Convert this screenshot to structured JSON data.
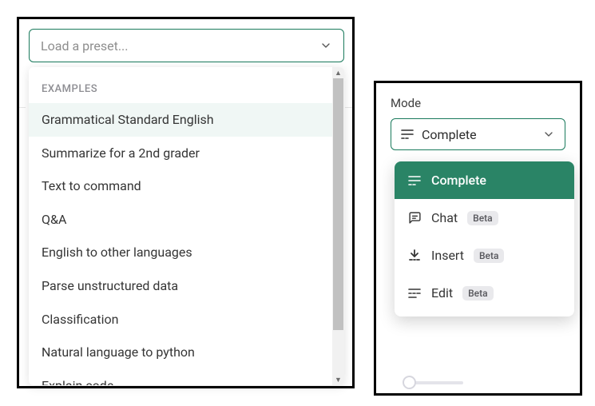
{
  "preset_selector": {
    "placeholder": "Load a preset..."
  },
  "preset_dropdown": {
    "section_label": "EXAMPLES",
    "options": [
      {
        "label": "Grammatical Standard English",
        "highlighted": true
      },
      {
        "label": "Summarize for a 2nd grader",
        "highlighted": false
      },
      {
        "label": "Text to command",
        "highlighted": false
      },
      {
        "label": "Q&A",
        "highlighted": false
      },
      {
        "label": "English to other languages",
        "highlighted": false
      },
      {
        "label": "Parse unstructured data",
        "highlighted": false
      },
      {
        "label": "Classification",
        "highlighted": false
      },
      {
        "label": "Natural language to python",
        "highlighted": false
      },
      {
        "label": "Explain code",
        "highlighted": false
      }
    ]
  },
  "mode_panel": {
    "label": "Mode",
    "selected": "Complete",
    "options": [
      {
        "label": "Complete",
        "icon": "complete-icon",
        "selected": true,
        "beta": false
      },
      {
        "label": "Chat",
        "icon": "chat-icon",
        "selected": false,
        "beta": true
      },
      {
        "label": "Insert",
        "icon": "insert-icon",
        "selected": false,
        "beta": true
      },
      {
        "label": "Edit",
        "icon": "edit-icon",
        "selected": false,
        "beta": true
      }
    ],
    "beta_label": "Beta"
  }
}
